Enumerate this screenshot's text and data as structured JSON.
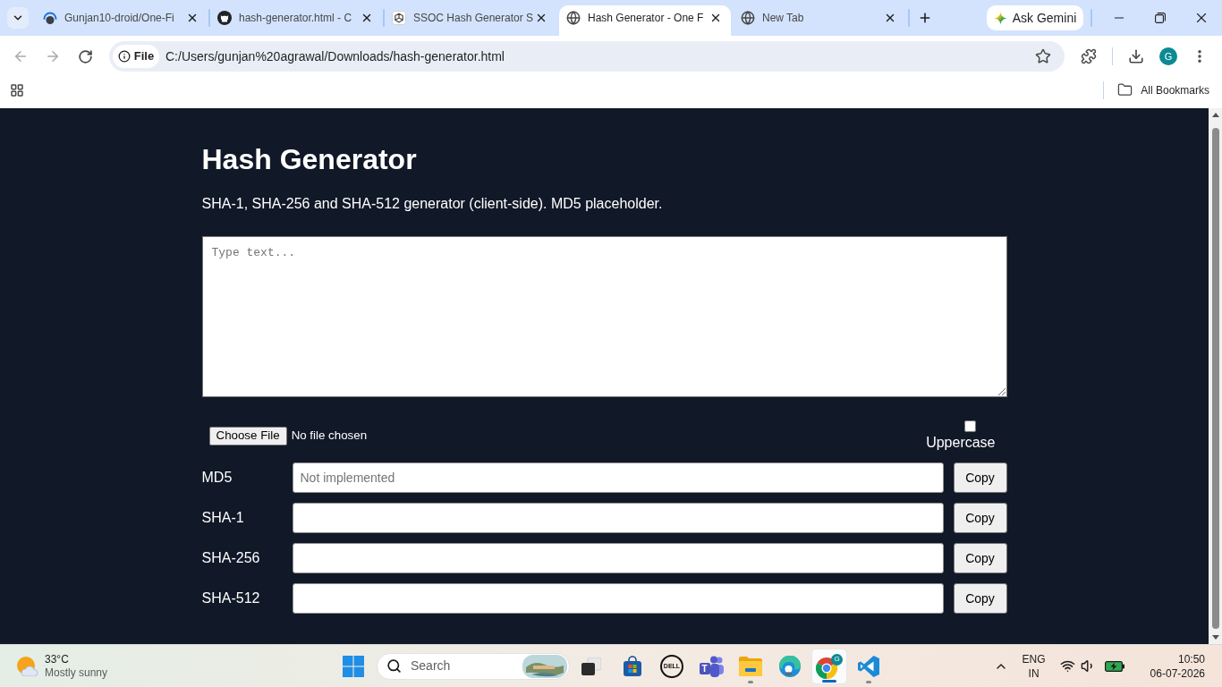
{
  "browser": {
    "tabs": [
      {
        "kind": "loading",
        "title": "Gunjan10-droid/One-Fi",
        "selected": false
      },
      {
        "kind": "dark-logo",
        "title": "hash-generator.html - C",
        "selected": false
      },
      {
        "kind": "knot-logo",
        "title": "SSOC Hash Generator S",
        "selected": false
      },
      {
        "kind": "globe",
        "title": "Hash Generator - One F",
        "selected": true
      },
      {
        "kind": "globe",
        "title": "New Tab",
        "selected": false
      }
    ],
    "gemini_button": "Ask Gemini",
    "address_bar": {
      "chip": "File",
      "url": "C:/Users/gunjan%20agrawal/Downloads/hash-generator.html"
    },
    "profile": "G",
    "bookmarks": "All Bookmarks"
  },
  "page": {
    "title": "Hash Generator",
    "description": "SHA-1, SHA-256 and SHA-512 generator (client-side). MD5 placeholder.",
    "text_input": {
      "placeholder": "Type text..."
    },
    "file_picker": {
      "button": "Choose File",
      "status": "No file chosen"
    },
    "uppercase": {
      "label": "Uppercase",
      "checked": false
    },
    "hashes": [
      {
        "label": "MD5",
        "placeholder": "Not implemented",
        "button": "Copy"
      },
      {
        "label": "SHA-1",
        "button": "Copy"
      },
      {
        "label": "SHA-256",
        "button": "Copy"
      },
      {
        "label": "SHA-512",
        "button": "Copy"
      }
    ]
  },
  "taskbar": {
    "weather": {
      "temperature": "33°C",
      "condition": "Mostly sunny"
    },
    "search": {
      "placeholder": "Search"
    },
    "apps": [
      {
        "kind": "store",
        "running": false,
        "selected": false
      },
      {
        "kind": "wordmark",
        "label": "DELL",
        "running": false,
        "selected": false
      },
      {
        "kind": "team-chat",
        "label": "T",
        "running": false,
        "selected": false
      },
      {
        "kind": "folder",
        "running": true,
        "selected": false
      },
      {
        "kind": "wave-browser",
        "running": false,
        "selected": false
      },
      {
        "kind": "ring-browser",
        "badge": "G",
        "running": true,
        "selected": true
      },
      {
        "kind": "code-editor",
        "running": true,
        "selected": false
      }
    ],
    "tray": {
      "language": "ENG",
      "region": "IN",
      "time": "10:50",
      "date": "06-07-2026"
    }
  }
}
